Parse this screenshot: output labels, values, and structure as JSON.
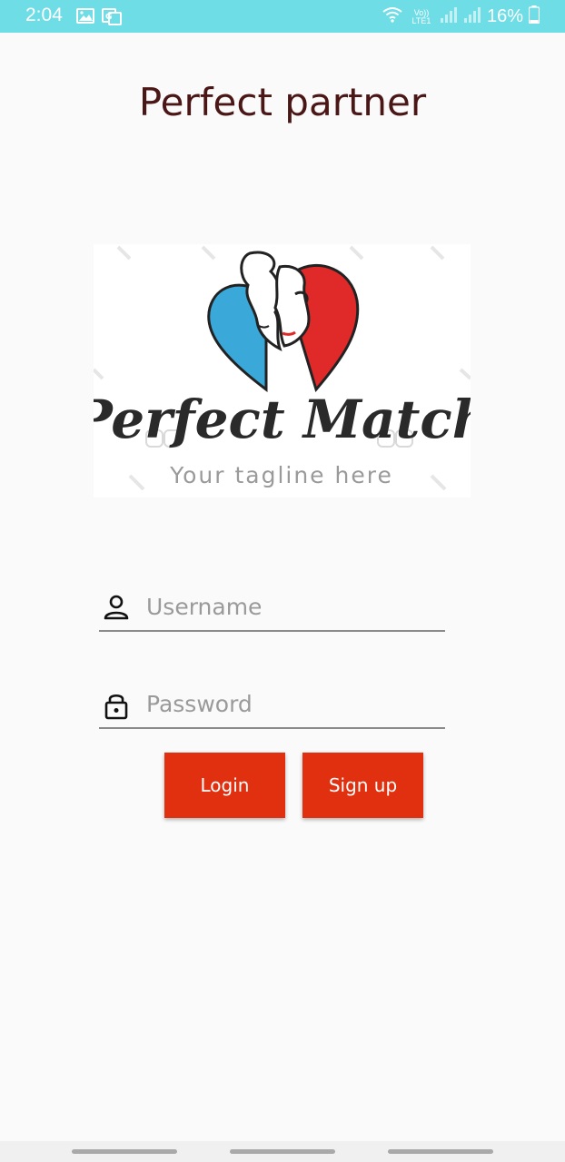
{
  "status_bar": {
    "time": "2:04",
    "network_label": "Vo)) LTE1",
    "battery": "16%",
    "color": "#6fdde6"
  },
  "app": {
    "title": "Perfect partner"
  },
  "logo": {
    "brand_name": "Perfect Match",
    "tagline": "Your tagline here",
    "heart_left_color": "#3aa8d8",
    "heart_right_color": "#e02a2a"
  },
  "form": {
    "username": {
      "placeholder": "Username",
      "value": "",
      "icon": "person-icon"
    },
    "password": {
      "placeholder": "Password",
      "value": "",
      "icon": "lock-icon"
    }
  },
  "buttons": {
    "login_label": "Login",
    "signup_label": "Sign up",
    "color": "#e0300f"
  },
  "nav_bar": {
    "items": [
      "recent-apps",
      "home",
      "back"
    ]
  }
}
